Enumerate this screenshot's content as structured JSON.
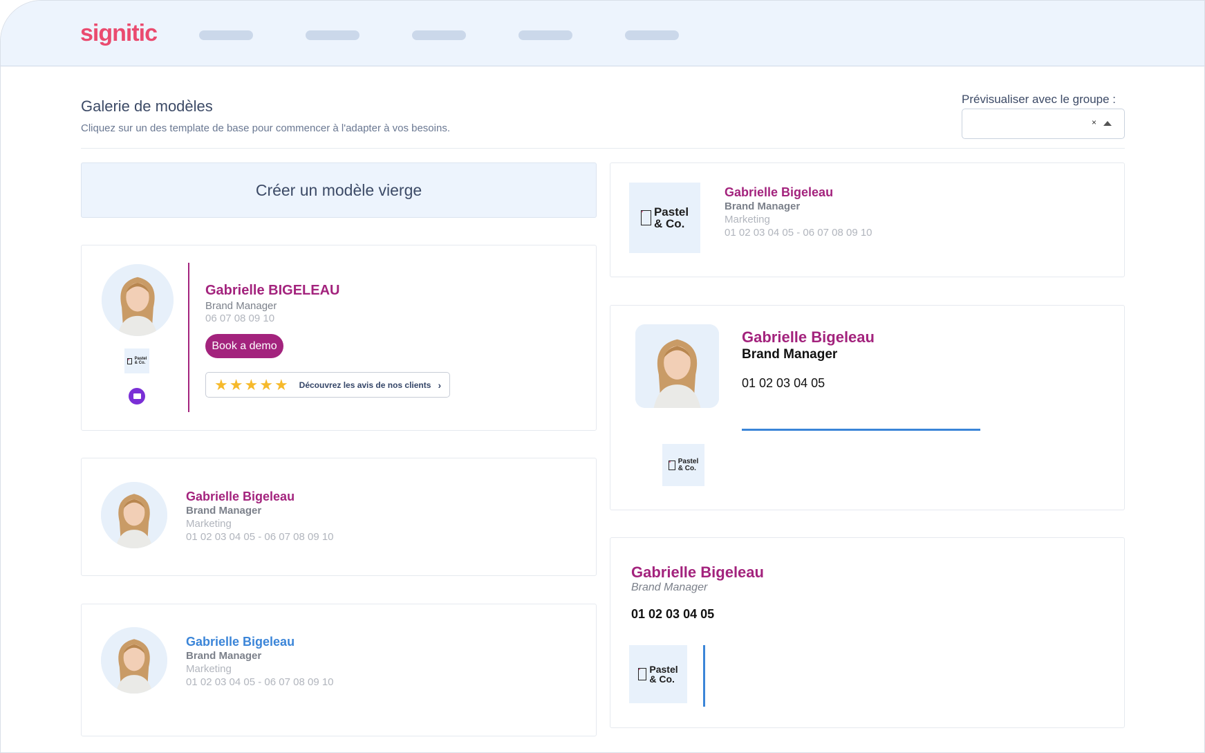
{
  "header": {
    "logo": "signitic",
    "nav": [
      "",
      "",
      "",
      "",
      ""
    ]
  },
  "page": {
    "title": "Galerie de modèles",
    "subtitle": "Cliquez sur un des template de base pour commencer à l'adapter à vos besoins.",
    "group_label": "Prévisualiser avec le groupe :",
    "group_value": "",
    "clear_icon": "×"
  },
  "blank_template": {
    "label": "Créer un modèle vierge"
  },
  "company_logo": {
    "line1": "Pastel",
    "line2": "& Co."
  },
  "templates": {
    "t1": {
      "name": "Gabrielle BIGELEAU",
      "title": "Brand Manager",
      "phone": "06 07 08 09 10",
      "button": "Book a demo",
      "reviews_text": "Découvrez les avis de nos clients",
      "rating": 5,
      "chevron": "›"
    },
    "t2": {
      "name": "Gabrielle Bigeleau",
      "title": "Brand Manager",
      "department": "Marketing",
      "phones": "01 02 03 04 05 - 06 07 08 09 10"
    },
    "t3": {
      "name": "Gabrielle Bigeleau",
      "title": "Brand Manager",
      "department": "Marketing",
      "phones": "01 02 03 04 05 - 06 07 08 09 10"
    },
    "t4": {
      "name": "Gabrielle Bigeleau",
      "title": "Brand Manager",
      "department": "Marketing",
      "phones": "01 02 03 04 05 - 06 07 08 09 10"
    },
    "t5": {
      "name": "Gabrielle Bigeleau",
      "title": "Brand Manager",
      "phone": "01 02 03 04 05"
    },
    "t6": {
      "name": "Gabrielle Bigeleau",
      "title": "Brand Manager",
      "phone": "01 02 03 04 05"
    }
  },
  "colors": {
    "brand": "#ea4b6f",
    "accent_magenta": "#a3237d",
    "accent_blue": "#3b85d8",
    "header_bg": "#edf4fd"
  }
}
